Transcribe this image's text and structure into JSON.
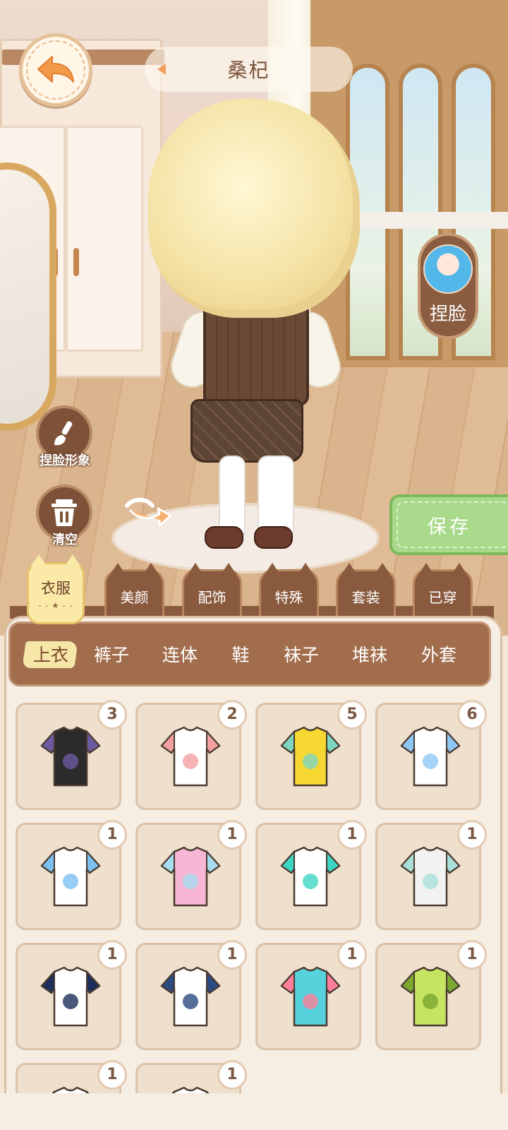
{
  "header": {
    "character_name": "桑杞"
  },
  "side_buttons": {
    "face_edit": "捏脸",
    "face_profile": "捏脸形象",
    "clear": "清空",
    "save": "保存"
  },
  "categories": {
    "active": "衣服",
    "tabs": [
      "美颜",
      "配饰",
      "特殊",
      "套装",
      "已穿"
    ]
  },
  "subcategories": {
    "active_index": 0,
    "items": [
      "上衣",
      "裤子",
      "连体",
      "鞋",
      "袜子",
      "堆袜",
      "外套"
    ]
  },
  "items": [
    {
      "name": "black-cat-shirt",
      "count": "3",
      "colors": [
        "#2b2b2b",
        "#6c5aa0"
      ]
    },
    {
      "name": "white-bunny-shirt",
      "count": "2",
      "colors": [
        "#ffffff",
        "#f2a0a0"
      ]
    },
    {
      "name": "yellow-shirt",
      "count": "5",
      "colors": [
        "#f7d832",
        "#7fd6c0"
      ]
    },
    {
      "name": "sun-tee",
      "count": "6",
      "colors": [
        "#ffffff",
        "#8ec7f2"
      ]
    },
    {
      "name": "rainbow-tee",
      "count": "1",
      "colors": [
        "#ffffff",
        "#7cc0f0"
      ]
    },
    {
      "name": "pastel-hoodie",
      "count": "1",
      "colors": [
        "#f6b6d4",
        "#a8dcef"
      ]
    },
    {
      "name": "graffiti-tank",
      "count": "1",
      "colors": [
        "#ffffff",
        "#3dd6c2"
      ]
    },
    {
      "name": "white-ribbon-blouse",
      "count": "1",
      "colors": [
        "#f2f2f2",
        "#a8e0d8"
      ]
    },
    {
      "name": "navy-sailor-top",
      "count": "1",
      "colors": [
        "#ffffff",
        "#1d2e5a"
      ]
    },
    {
      "name": "blue-tie-sailor",
      "count": "1",
      "colors": [
        "#ffffff",
        "#2c4b80"
      ]
    },
    {
      "name": "teal-dress-top",
      "count": "1",
      "colors": [
        "#55d2dc",
        "#ff7e9a"
      ]
    },
    {
      "name": "green-hanfu",
      "count": "1",
      "colors": [
        "#c6e462",
        "#7aa830"
      ]
    },
    {
      "name": "partial-item-13",
      "count": "1",
      "colors": [
        "#ffffff",
        "#6ab0e8"
      ]
    },
    {
      "name": "partial-item-14",
      "count": "1",
      "colors": [
        "#ffffff",
        "#e8b840"
      ]
    }
  ]
}
